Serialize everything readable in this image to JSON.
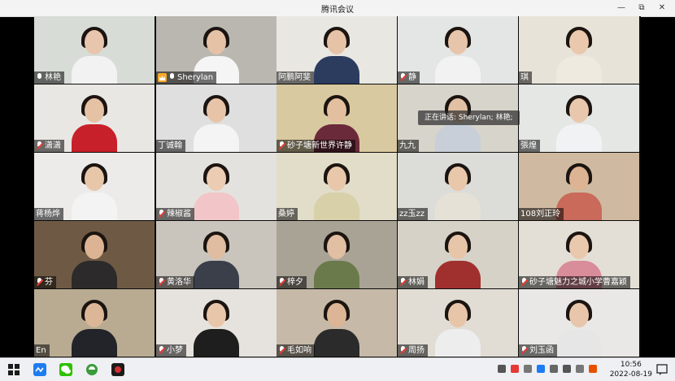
{
  "window": {
    "title": "腾讯会议",
    "minimize": "—",
    "restore": "⧉",
    "close": "✕"
  },
  "speaking": {
    "text": "正在讲话: Sherylan; 林艳;"
  },
  "participants": [
    {
      "name": "林艳",
      "mic": "on",
      "host": false,
      "bg": "#d8dcd6",
      "skin": "#e8c6ad",
      "shirt": "#f2f2f2"
    },
    {
      "name": "Sherylan",
      "mic": "on",
      "host": true,
      "bg": "#b9b7b0",
      "skin": "#e5c2a6",
      "shirt": "#f5f5f5"
    },
    {
      "name": "阿鹏阿斐",
      "mic": "none",
      "host": false,
      "bg": "#e9e7e2",
      "skin": "#e6c3a6",
      "shirt": "#2b3c5e"
    },
    {
      "name": "静",
      "mic": "muted",
      "host": false,
      "bg": "#e3e6e4",
      "skin": "#e7c5aa",
      "shirt": "#f2f2f2"
    },
    {
      "name": "琪",
      "mic": "none",
      "host": false,
      "bg": "#e8e3d8",
      "skin": "#e9c8ad",
      "shirt": "#efeae0"
    },
    {
      "name": "潇潇",
      "mic": "muted",
      "host": false,
      "bg": "#e9e7e3",
      "skin": "#e6c2a4",
      "shirt": "#c8202a"
    },
    {
      "name": "丁诚翰",
      "mic": "none",
      "host": false,
      "bg": "#dedfde",
      "skin": "#e7c4a8",
      "shirt": "#f4f4f4"
    },
    {
      "name": "砂子塘新世界许静",
      "mic": "muted",
      "host": false,
      "bg": "#d9c9a0",
      "skin": "#e4bf9f",
      "shirt": "#6b2a3a"
    },
    {
      "name": "九九",
      "mic": "none",
      "host": false,
      "bg": "#d7d4cb",
      "skin": "#e2c0a4",
      "shirt": "#c8cfd8"
    },
    {
      "name": "張煌",
      "mic": "none",
      "host": false,
      "bg": "#e5e7e5",
      "skin": "#e8c7ac",
      "shirt": "#f0f2f4"
    },
    {
      "name": "蒋杨烨",
      "mic": "none",
      "host": false,
      "bg": "#ecebea",
      "skin": "#e8c6aa",
      "shirt": "#f3f3f3"
    },
    {
      "name": "辣椒酱",
      "mic": "muted",
      "host": false,
      "bg": "#e4e2df",
      "skin": "#ecccb2",
      "shirt": "#f2c6c8"
    },
    {
      "name": "桑婷",
      "mic": "none",
      "host": false,
      "bg": "#e2ddc9",
      "skin": "#e8c7aa",
      "shirt": "#d8d0a8"
    },
    {
      "name": "zz玉zz",
      "mic": "none",
      "host": false,
      "bg": "#dcdcd8",
      "skin": "#e8c7ab",
      "shirt": "#e6e1d6"
    },
    {
      "name": "108刘正玲",
      "mic": "none",
      "host": false,
      "bg": "#cfb9a0",
      "skin": "#dcb493",
      "shirt": "#c96a5a"
    },
    {
      "name": "芬",
      "mic": "muted",
      "host": false,
      "bg": "#6e5a44",
      "skin": "#dcb494",
      "shirt": "#2c2a2a"
    },
    {
      "name": "黄洛华",
      "mic": "muted",
      "host": false,
      "bg": "#c9c4bc",
      "skin": "#e0bda0",
      "shirt": "#3a3f4a"
    },
    {
      "name": "梓夕",
      "mic": "muted",
      "host": false,
      "bg": "#a9a396",
      "skin": "#e1bfa2",
      "shirt": "#6a7a4a"
    },
    {
      "name": "林娟",
      "mic": "muted",
      "host": false,
      "bg": "#d6d2c8",
      "skin": "#e7c5a8",
      "shirt": "#a0302e"
    },
    {
      "name": "砂子塘魅力之城小学曹嘉颖",
      "mic": "muted",
      "host": false,
      "bg": "#e3dfd6",
      "skin": "#e9c8ad",
      "shirt": "#d98c9a"
    },
    {
      "name": "En",
      "mic": "none",
      "host": false,
      "bg": "#b8ab92",
      "skin": "#dbb798",
      "shirt": "#23232a"
    },
    {
      "name": "小梦",
      "mic": "muted",
      "host": false,
      "bg": "#e6e3de",
      "skin": "#e8c6aa",
      "shirt": "#1e1e1e"
    },
    {
      "name": "毛如响",
      "mic": "muted",
      "host": false,
      "bg": "#c6b9a8",
      "skin": "#dcb596",
      "shirt": "#2b2b2b"
    },
    {
      "name": "周扬",
      "mic": "muted",
      "host": false,
      "bg": "#e1ddd5",
      "skin": "#e7c5a9",
      "shirt": "#ededed"
    },
    {
      "name": "刘玉函",
      "mic": "muted",
      "host": false,
      "bg": "#e9e8e6",
      "skin": "#e7c6ab",
      "shirt": "#e6e6e6"
    }
  ],
  "taskbar": {
    "time": "10:56",
    "date": "2022-08-19"
  }
}
